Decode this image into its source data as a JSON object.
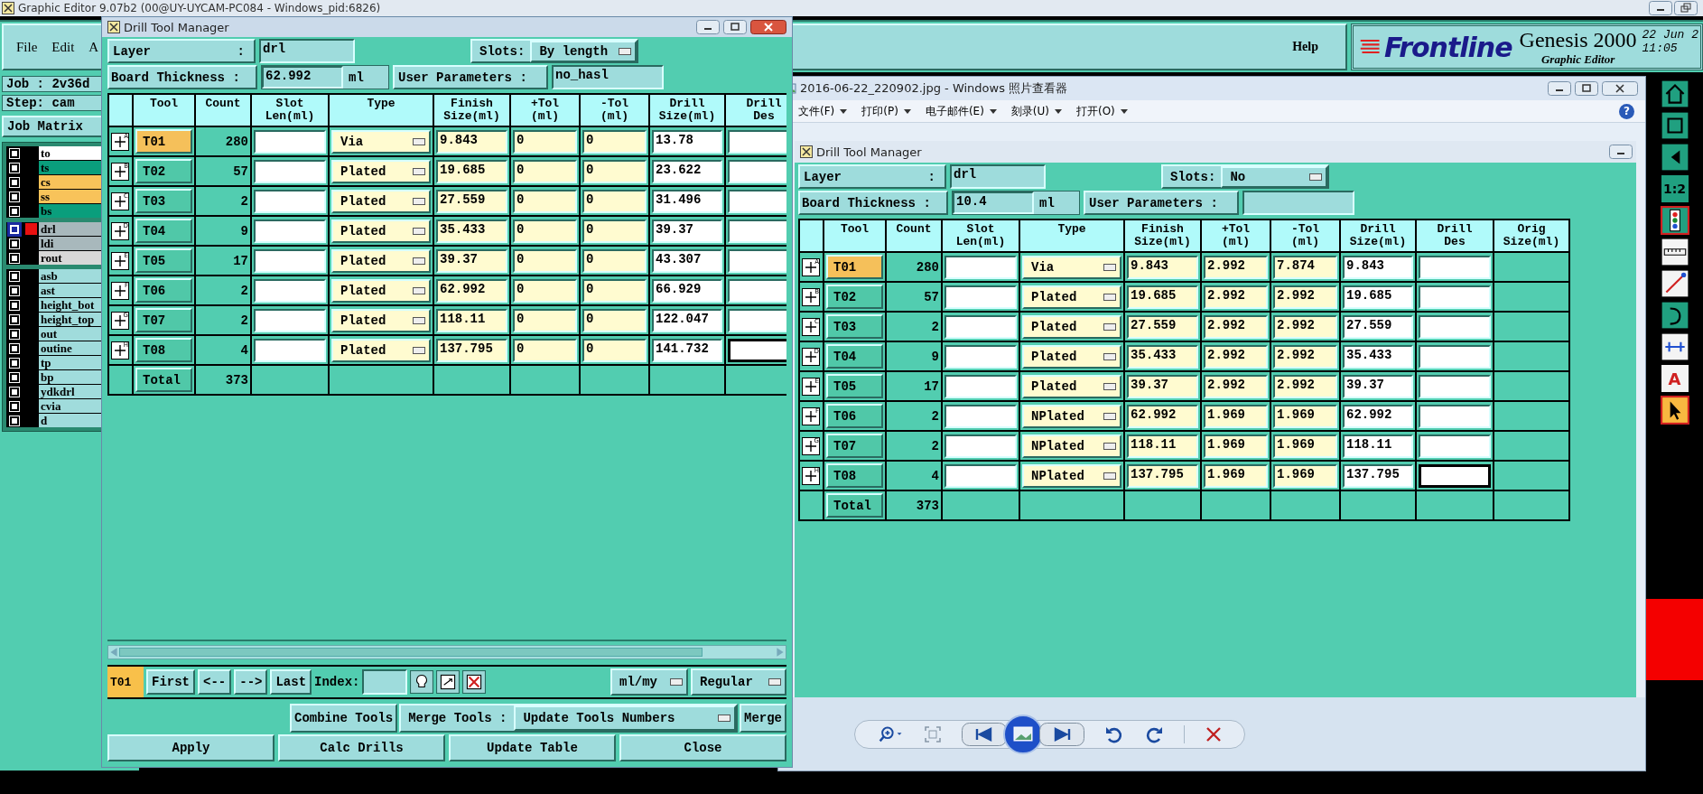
{
  "editor": {
    "title": "Graphic Editor 9.07b2 (00@UY-UYCAM-PC084 - Windows_pid:6826)",
    "menu": [
      "File",
      "Edit",
      "A"
    ],
    "help": "Help",
    "brand": "Frontline",
    "product": "Genesis 2000",
    "subtitle": "Graphic Editor",
    "date": "22 Jun 2",
    "time": "11:05",
    "job": "Job : 2v36d",
    "step": "Step: cam",
    "job_matrix": "Job Matrix",
    "layer_groups": [
      [
        {
          "name": "to",
          "color": "#ffffff",
          "selected": false
        },
        {
          "name": "ts",
          "color": "#0a9e7c",
          "selected": false
        },
        {
          "name": "cs",
          "color": "#f8c35a",
          "selected": false
        },
        {
          "name": "ss",
          "color": "#f8c35a",
          "selected": false
        },
        {
          "name": "bs",
          "color": "#0a9e7c",
          "selected": false
        }
      ],
      [
        {
          "name": "drl",
          "color": "#a8b8bc",
          "selected": true
        },
        {
          "name": "ldi",
          "color": "#a8b8bc",
          "selected": false
        },
        {
          "name": "rout",
          "color": "#d8d8d8",
          "selected": false
        }
      ],
      [
        {
          "name": "asb",
          "color": "#a0dcdc",
          "selected": false
        },
        {
          "name": "ast",
          "color": "#a0dcdc",
          "selected": false
        },
        {
          "name": "height_bot",
          "color": "#a0dcdc",
          "selected": false
        },
        {
          "name": "height_top",
          "color": "#a0dcdc",
          "selected": false
        },
        {
          "name": "out",
          "color": "#a0dcdc",
          "selected": false
        },
        {
          "name": "outine",
          "color": "#a0dcdc",
          "selected": false
        },
        {
          "name": "tp",
          "color": "#a0dcdc",
          "selected": false
        },
        {
          "name": "bp",
          "color": "#a0dcdc",
          "selected": false
        },
        {
          "name": "ydkdrl",
          "color": "#a0dcdc",
          "selected": false
        },
        {
          "name": "cvia",
          "color": "#a0dcdc",
          "selected": false
        },
        {
          "name": "d",
          "color": "#a0dcdc",
          "selected": false
        }
      ]
    ],
    "tools": [
      {
        "kind": "home"
      },
      {
        "kind": "frame"
      },
      {
        "kind": "arrow"
      },
      {
        "kind": "ratio",
        "label": "1:2"
      },
      {
        "kind": "lights"
      },
      {
        "kind": "ruler"
      },
      {
        "kind": "line"
      },
      {
        "kind": "curve"
      },
      {
        "kind": "measure"
      },
      {
        "kind": "letter",
        "label": "A"
      },
      {
        "kind": "cursor"
      }
    ]
  },
  "dialog": {
    "title": "Drill Tool Manager",
    "layer_label": "Layer",
    "layer_colon": ":",
    "layer": "drl",
    "slots_label": "Slots:",
    "slots": "By length",
    "thickness_label": "Board Thickness :",
    "thickness": "62.992",
    "unit": "ml",
    "user_params_label": "User Parameters :",
    "user_params": "no_hasl",
    "columns": [
      {
        "kind": "tool",
        "label": "Tool"
      },
      {
        "kind": "count",
        "label": "Count"
      },
      {
        "kind": "slot",
        "label": "Slot\nLen(ml)"
      },
      {
        "kind": "type",
        "label": "Type"
      },
      {
        "kind": "finish",
        "label": "Finish\nSize(ml)"
      },
      {
        "kind": "plus_tol",
        "label": "+Tol\n(ml)"
      },
      {
        "kind": "minus_tol",
        "label": "-Tol\n(ml)"
      },
      {
        "kind": "drill_size",
        "label": "Drill\nSize(ml)"
      },
      {
        "kind": "drill_des",
        "label": "Drill\nDes"
      }
    ],
    "rows": [
      {
        "marker": "A",
        "tool": "T01",
        "selected": true,
        "count": "280",
        "type": "Via",
        "finish": "9.843",
        "plus_tol": "0",
        "minus_tol": "0",
        "drill_size": "13.78",
        "focused": false
      },
      {
        "marker": "B",
        "tool": "T02",
        "selected": false,
        "count": "57",
        "type": "Plated",
        "finish": "19.685",
        "plus_tol": "0",
        "minus_tol": "0",
        "drill_size": "23.622",
        "focused": false
      },
      {
        "marker": "C",
        "tool": "T03",
        "selected": false,
        "count": "2",
        "type": "Plated",
        "finish": "27.559",
        "plus_tol": "0",
        "minus_tol": "0",
        "drill_size": "31.496",
        "focused": false
      },
      {
        "marker": "D",
        "tool": "T04",
        "selected": false,
        "count": "9",
        "type": "Plated",
        "finish": "35.433",
        "plus_tol": "0",
        "minus_tol": "0",
        "drill_size": "39.37",
        "focused": false
      },
      {
        "marker": "E",
        "tool": "T05",
        "selected": false,
        "count": "17",
        "type": "Plated",
        "finish": "39.37",
        "plus_tol": "0",
        "minus_tol": "0",
        "drill_size": "43.307",
        "focused": false
      },
      {
        "marker": "F",
        "tool": "T06",
        "selected": false,
        "count": "2",
        "type": "Plated",
        "finish": "62.992",
        "plus_tol": "0",
        "minus_tol": "0",
        "drill_size": "66.929",
        "focused": false
      },
      {
        "marker": "G",
        "tool": "T07",
        "selected": false,
        "count": "2",
        "type": "Plated",
        "finish": "118.11",
        "plus_tol": "0",
        "minus_tol": "0",
        "drill_size": "122.047",
        "focused": false
      },
      {
        "marker": "H",
        "tool": "T08",
        "selected": false,
        "count": "4",
        "type": "Plated",
        "finish": "137.795",
        "plus_tol": "0",
        "minus_tol": "0",
        "drill_size": "141.732",
        "focused": true
      }
    ],
    "total": {
      "label": "Total",
      "count": "373"
    },
    "nav": {
      "current": "T01",
      "buttons": [
        "First",
        "<--",
        "-->",
        "Last"
      ],
      "index_label": "Index:",
      "units": "ml/my",
      "mode": "Regular"
    },
    "merge": {
      "combine": "Combine Tools",
      "label": "Merge Tools :",
      "option": "Update Tools Numbers",
      "merge": "Merge"
    },
    "buttons": [
      "Apply",
      "Calc Drills",
      "Update Table",
      "Close"
    ]
  },
  "viewer": {
    "title": "2016-06-22_220902.jpg - Windows 照片查看器",
    "menu": [
      "文件(F)",
      "打印(P)",
      "电子邮件(E)",
      "刻录(U)",
      "打开(O)"
    ],
    "help": "?",
    "image": {
      "title": "Drill Tool Manager",
      "layer_label": "Layer",
      "layer_colon": ":",
      "layer": "drl",
      "slots_label": "Slots:",
      "slots": "No",
      "thickness_label": "Board Thickness :",
      "thickness": "10.4",
      "unit": "ml",
      "user_params_label": "User Parameters :",
      "columns": [
        {
          "kind": "tool",
          "label": "Tool"
        },
        {
          "kind": "count",
          "label": "Count"
        },
        {
          "kind": "slot",
          "label": "Slot\nLen(ml)"
        },
        {
          "kind": "type",
          "label": "Type"
        },
        {
          "kind": "finish",
          "label": "Finish\nSize(ml)"
        },
        {
          "kind": "plus_tol",
          "label": "+Tol\n(ml)"
        },
        {
          "kind": "minus_tol",
          "label": "-Tol\n(ml)"
        },
        {
          "kind": "drill_size",
          "label": "Drill\nSize(ml)"
        },
        {
          "kind": "drill_des",
          "label": "Drill\nDes"
        },
        {
          "kind": "orig",
          "label": "Orig\nSize(ml)"
        }
      ],
      "rows": [
        {
          "marker": "A",
          "tool": "T01",
          "selected": true,
          "count": "280",
          "type": "Via",
          "finish": "9.843",
          "plus_tol": "2.992",
          "minus_tol": "7.874",
          "drill_size": "9.843",
          "focused": false
        },
        {
          "marker": "B",
          "tool": "T02",
          "selected": false,
          "count": "57",
          "type": "Plated",
          "finish": "19.685",
          "plus_tol": "2.992",
          "minus_tol": "2.992",
          "drill_size": "19.685",
          "focused": false
        },
        {
          "marker": "C",
          "tool": "T03",
          "selected": false,
          "count": "2",
          "type": "Plated",
          "finish": "27.559",
          "plus_tol": "2.992",
          "minus_tol": "2.992",
          "drill_size": "27.559",
          "focused": false
        },
        {
          "marker": "D",
          "tool": "T04",
          "selected": false,
          "count": "9",
          "type": "Plated",
          "finish": "35.433",
          "plus_tol": "2.992",
          "minus_tol": "2.992",
          "drill_size": "35.433",
          "focused": false
        },
        {
          "marker": "E",
          "tool": "T05",
          "selected": false,
          "count": "17",
          "type": "Plated",
          "finish": "39.37",
          "plus_tol": "2.992",
          "minus_tol": "2.992",
          "drill_size": "39.37",
          "focused": false
        },
        {
          "marker": "F",
          "tool": "T06",
          "selected": false,
          "count": "2",
          "type": "NPlated",
          "finish": "62.992",
          "plus_tol": "1.969",
          "minus_tol": "1.969",
          "drill_size": "62.992",
          "focused": false
        },
        {
          "marker": "G",
          "tool": "T07",
          "selected": false,
          "count": "2",
          "type": "NPlated",
          "finish": "118.11",
          "plus_tol": "1.969",
          "minus_tol": "1.969",
          "drill_size": "118.11",
          "focused": false
        },
        {
          "marker": "H",
          "tool": "T08",
          "selected": false,
          "count": "4",
          "type": "NPlated",
          "finish": "137.795",
          "plus_tol": "1.969",
          "minus_tol": "1.969",
          "drill_size": "137.795",
          "focused": true
        }
      ],
      "total": {
        "label": "Total",
        "count": "373"
      }
    }
  }
}
